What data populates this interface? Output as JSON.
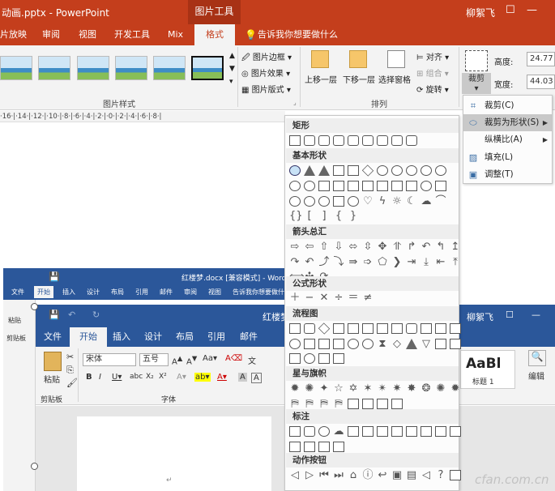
{
  "colors": {
    "ppt_accent": "#c43e1c",
    "word_accent": "#2b579a",
    "menu_highlight": "#c9c9c9"
  },
  "ppt": {
    "title": "动画.pptx - PowerPoint",
    "context_tab": "图片工具",
    "user": "柳絮飞",
    "tabs": [
      "片放映",
      "审阅",
      "视图",
      "开发工具",
      "Mix",
      "格式"
    ],
    "tell_me": "告诉我你想要做什么",
    "ribbon": {
      "picture_border": "图片边框",
      "picture_effects": "图片效果",
      "picture_layout": "图片版式",
      "group_picture_styles": "图片样式",
      "bring_forward": "上移一层",
      "send_backward": "下移一层",
      "selection_pane": "选择窗格",
      "align": "对齐",
      "group": "组合",
      "rotate": "旋转",
      "group_arrange": "排列",
      "crop": "裁剪",
      "height_label": "高度:",
      "height_value": "24.77",
      "width_label": "宽度:",
      "width_value": "44.03"
    },
    "ruler": "·16·|·14·|·12·|·10·|·8·|·6·|·4·|·2·|·0·|·2·|·4·|·6·|·8·|"
  },
  "crop_menu": {
    "items": [
      {
        "label": "裁剪(C)",
        "icon": "crop-icon"
      },
      {
        "label": "裁剪为形状(S)",
        "icon": "crop-shape-icon"
      },
      {
        "label": "纵横比(A)",
        "icon": ""
      },
      {
        "label": "填充(L)",
        "icon": "fill-icon"
      },
      {
        "label": "调整(T)",
        "icon": "fit-icon"
      }
    ]
  },
  "shape_menu": {
    "sections": [
      "矩形",
      "基本形状",
      "箭头总汇",
      "公式形状",
      "流程图",
      "星与旗帜",
      "标注",
      "动作按钮"
    ]
  },
  "word_back": {
    "title": "红楼梦.docx [兼容模式] - Word",
    "tabs": [
      "文件",
      "开始",
      "插入",
      "设计",
      "布局",
      "引用",
      "邮件",
      "审阅",
      "视图"
    ],
    "tell_me": "告诉我你想要做什么",
    "paste": "粘贴",
    "clipboard": "剪贴板"
  },
  "word_front": {
    "title": "红楼梦",
    "user": "柳絮飞",
    "tabs": [
      "文件",
      "开始",
      "插入",
      "设计",
      "布局",
      "引用",
      "邮件"
    ],
    "paste": "粘贴",
    "clipboard": "剪贴板",
    "font_name": "宋体",
    "font_size": "五号",
    "font_group": "字体",
    "style_preview": "AaBl",
    "style_name": "标题 1",
    "editing": "编辑"
  },
  "watermark": "cfan.com.cn"
}
